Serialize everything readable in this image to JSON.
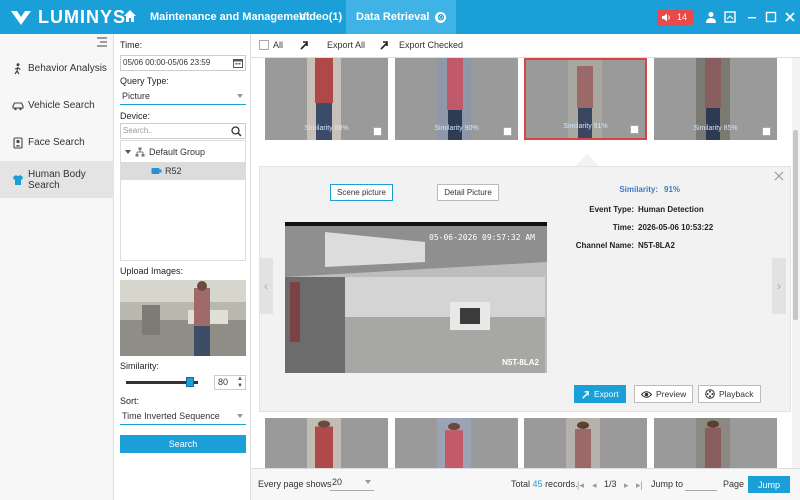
{
  "app": {
    "brand": "LUMINYS"
  },
  "tabs": [
    {
      "label": "Maintenance and Management"
    },
    {
      "label": "Video(1)"
    },
    {
      "label": "Data Retrieval",
      "close": "⊗"
    }
  ],
  "alarm": {
    "count": "14"
  },
  "nav": {
    "items": [
      {
        "label": "Behavior Analysis",
        "icon": "walking-person-icon"
      },
      {
        "label": "Vehicle Search",
        "icon": "car-icon"
      },
      {
        "label": "Face Search",
        "icon": "face-icon"
      },
      {
        "label": "Human Body Search",
        "icon": "shirt-icon"
      }
    ]
  },
  "filter": {
    "time_label": "Time:",
    "time_value": "05/06 00:00-05/06 23:59",
    "query_type_label": "Query Type:",
    "query_type_value": "Picture",
    "device_label": "Device:",
    "device_search_placeholder": "Search..",
    "tree": {
      "group": "Default Group",
      "device": "R52"
    },
    "upload_label": "Upload Images:",
    "similarity_label": "Similarity:",
    "similarity_value": "80",
    "similarity_level": 0.8,
    "sort_label": "Sort:",
    "sort_value": "Time Inverted Sequence",
    "search_button": "Search"
  },
  "toolbar": {
    "all": "All",
    "export_all": "Export All",
    "export_checked": "Export Checked"
  },
  "results_top": [
    {
      "similarity": "Similarity 88%"
    },
    {
      "similarity": "Similarity 90%"
    },
    {
      "similarity": "Similarity 91%",
      "selected": true
    },
    {
      "similarity": "Similarity 85%"
    }
  ],
  "detail": {
    "scene_button": "Scene picture",
    "detail_button": "Detail Picture",
    "overlay_timestamp": "05-06-2026 09:57:32 AM",
    "overlay_channel": "N5T-8LA2",
    "info": [
      {
        "label": "Similarity:",
        "value": "91%"
      },
      {
        "label": "Event Type:",
        "value": "Human Detection"
      },
      {
        "label": "Time:",
        "value": "2026-05-06 10:53:22"
      },
      {
        "label": "Channel Name:",
        "value": "N5T-8LA2"
      }
    ],
    "export_button": "Export",
    "preview_button": "Preview",
    "playback_button": "Playback"
  },
  "footer": {
    "per_page_label": "Every page shows",
    "per_page_value": "20",
    "total_prefix": "Total",
    "total_count": "45",
    "total_suffix": "records.",
    "page": "1/3",
    "jump_label": "Jump to",
    "page_word": "Page",
    "jump_button": "Jump"
  },
  "colors": {
    "accent": "#1a9fd9",
    "alarm": "#e84a4a",
    "selected_border": "#d64545"
  }
}
